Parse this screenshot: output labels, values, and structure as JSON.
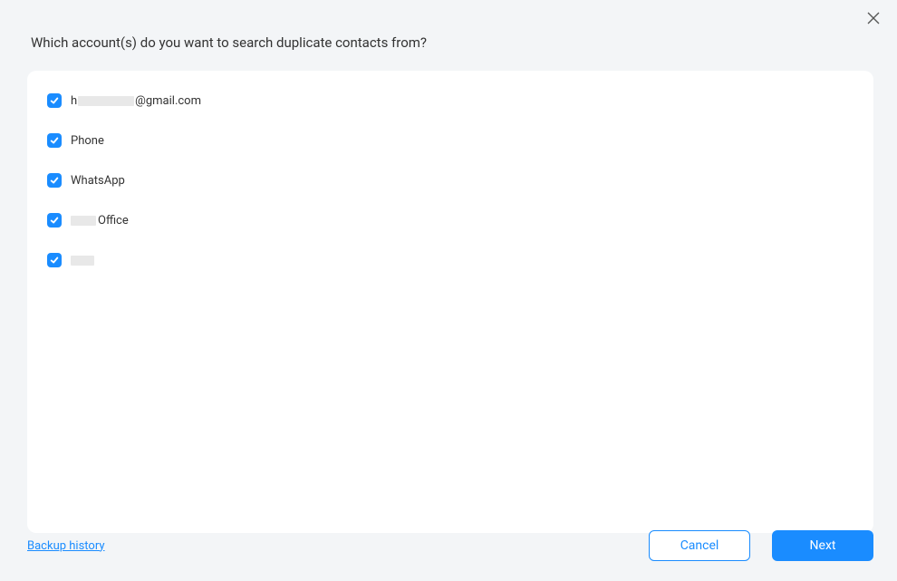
{
  "dialog": {
    "title": "Which account(s) do you want to search duplicate contacts from?"
  },
  "accounts": [
    {
      "checked": true,
      "label_prefix": "h",
      "label_suffix": "@gmail.com",
      "redacted_middle": true
    },
    {
      "checked": true,
      "label": "Phone"
    },
    {
      "checked": true,
      "label": "WhatsApp"
    },
    {
      "checked": true,
      "label_suffix": " Office",
      "redacted_prefix": true
    },
    {
      "checked": true,
      "redacted_full": true
    }
  ],
  "footer": {
    "backup_history": "Backup history",
    "cancel": "Cancel",
    "next": "Next"
  }
}
